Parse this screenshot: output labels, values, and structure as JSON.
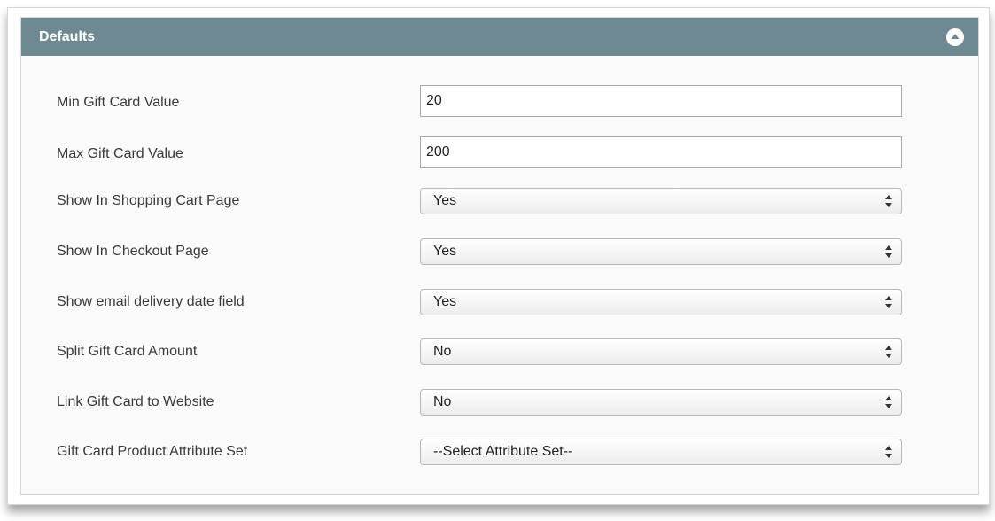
{
  "panel": {
    "title": "Defaults",
    "collapse_icon": "chevron-up-circle-icon"
  },
  "fields": [
    {
      "id": "min-gift-card-value",
      "label": "Min Gift Card Value",
      "type": "text",
      "value": "20"
    },
    {
      "id": "max-gift-card-value",
      "label": "Max Gift Card Value",
      "type": "text",
      "value": "200"
    },
    {
      "id": "show-in-shopping-cart-page",
      "label": "Show In Shopping Cart Page",
      "type": "select",
      "value": "Yes"
    },
    {
      "id": "show-in-checkout-page",
      "label": "Show In Checkout Page",
      "type": "select",
      "value": "Yes"
    },
    {
      "id": "show-email-delivery-date-field",
      "label": "Show email delivery date field",
      "type": "select",
      "value": "Yes"
    },
    {
      "id": "split-gift-card-amount",
      "label": "Split Gift Card Amount",
      "type": "select",
      "value": "No"
    },
    {
      "id": "link-gift-card-to-website",
      "label": "Link Gift Card to Website",
      "type": "select",
      "value": "No"
    },
    {
      "id": "gift-card-product-attribute-set",
      "label": "Gift Card Product Attribute Set",
      "type": "select",
      "value": "--Select Attribute Set--"
    }
  ],
  "colors": {
    "header_bg": "#6f8992",
    "header_text": "#ffffff",
    "panel_bg": "#fafafa"
  }
}
